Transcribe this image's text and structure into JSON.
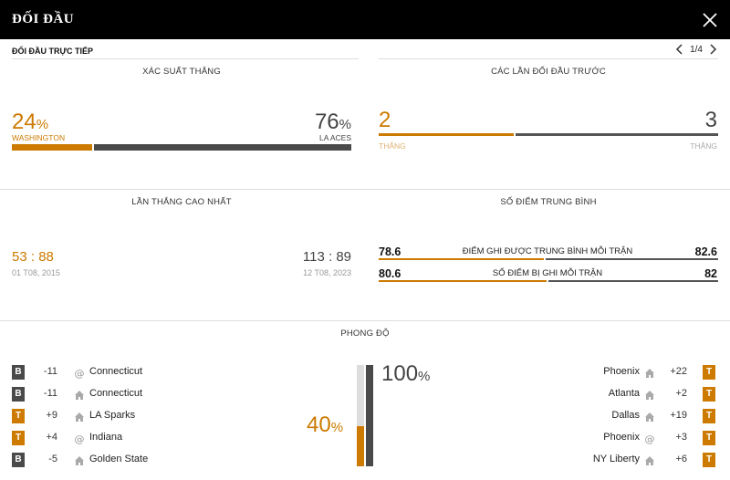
{
  "header": {
    "title": "ĐỐI ĐẦU"
  },
  "subheader": {
    "label": "ĐỐI ĐẦU TRỰC TIẾP",
    "page": "1/4"
  },
  "win_probability": {
    "title": "XÁC SUẤT THẮNG",
    "left_pct": "24",
    "left_team": "WASHINGTON",
    "right_pct": "76",
    "right_team": "LA ACES",
    "pct_sign": "%",
    "left_share": 0.24
  },
  "previous_meetings": {
    "title": "CÁC LẦN ĐỐI ĐẦU TRƯỚC",
    "left_wins": "2",
    "left_label": "THẮNG",
    "right_wins": "3",
    "right_label": "THẮNG",
    "left_share": 0.4
  },
  "biggest_win": {
    "title": "LẦN THẮNG CAO NHẤT",
    "left_score_a": "53",
    "left_score_b": "88",
    "left_date": "01 T08, 2015",
    "right_score_a": "113",
    "right_score_b": "89",
    "right_date": "12 T08, 2023",
    "sep": ":"
  },
  "average_points": {
    "title": "SỐ ĐIỂM TRUNG BÌNH",
    "rows": [
      {
        "left": "78.6",
        "label": "ĐIỂM GHI ĐƯỢC TRUNG BÌNH MỖI TRẬN",
        "right": "82.6",
        "left_share": 0.488
      },
      {
        "left": "80.6",
        "label": "SỐ ĐIỂM BỊ GHI MỖI TRẬN",
        "right": "82",
        "left_share": 0.496
      }
    ]
  },
  "form": {
    "title": "PHONG ĐỘ",
    "left_pct": "40",
    "right_pct": "100",
    "pct_sign": "%",
    "left_share": 0.4,
    "right_share": 1.0,
    "left_games": [
      {
        "result": "B",
        "diff": "-11",
        "venue": "away",
        "opponent": "Connecticut"
      },
      {
        "result": "B",
        "diff": "-11",
        "venue": "home",
        "opponent": "Connecticut"
      },
      {
        "result": "T",
        "diff": "+9",
        "venue": "home",
        "opponent": "LA Sparks"
      },
      {
        "result": "T",
        "diff": "+4",
        "venue": "away",
        "opponent": "Indiana"
      },
      {
        "result": "B",
        "diff": "-5",
        "venue": "home",
        "opponent": "Golden State"
      }
    ],
    "right_games": [
      {
        "result": "T",
        "diff": "+22",
        "venue": "home",
        "opponent": "Phoenix"
      },
      {
        "result": "T",
        "diff": "+2",
        "venue": "home",
        "opponent": "Atlanta"
      },
      {
        "result": "T",
        "diff": "+19",
        "venue": "home",
        "opponent": "Dallas"
      },
      {
        "result": "T",
        "diff": "+3",
        "venue": "away",
        "opponent": "Phoenix"
      },
      {
        "result": "T",
        "diff": "+6",
        "venue": "home",
        "opponent": "NY Liberty"
      }
    ]
  },
  "colors": {
    "accent": "#cc7a00",
    "dark": "#4a4a4a",
    "light": "#dddddd"
  }
}
